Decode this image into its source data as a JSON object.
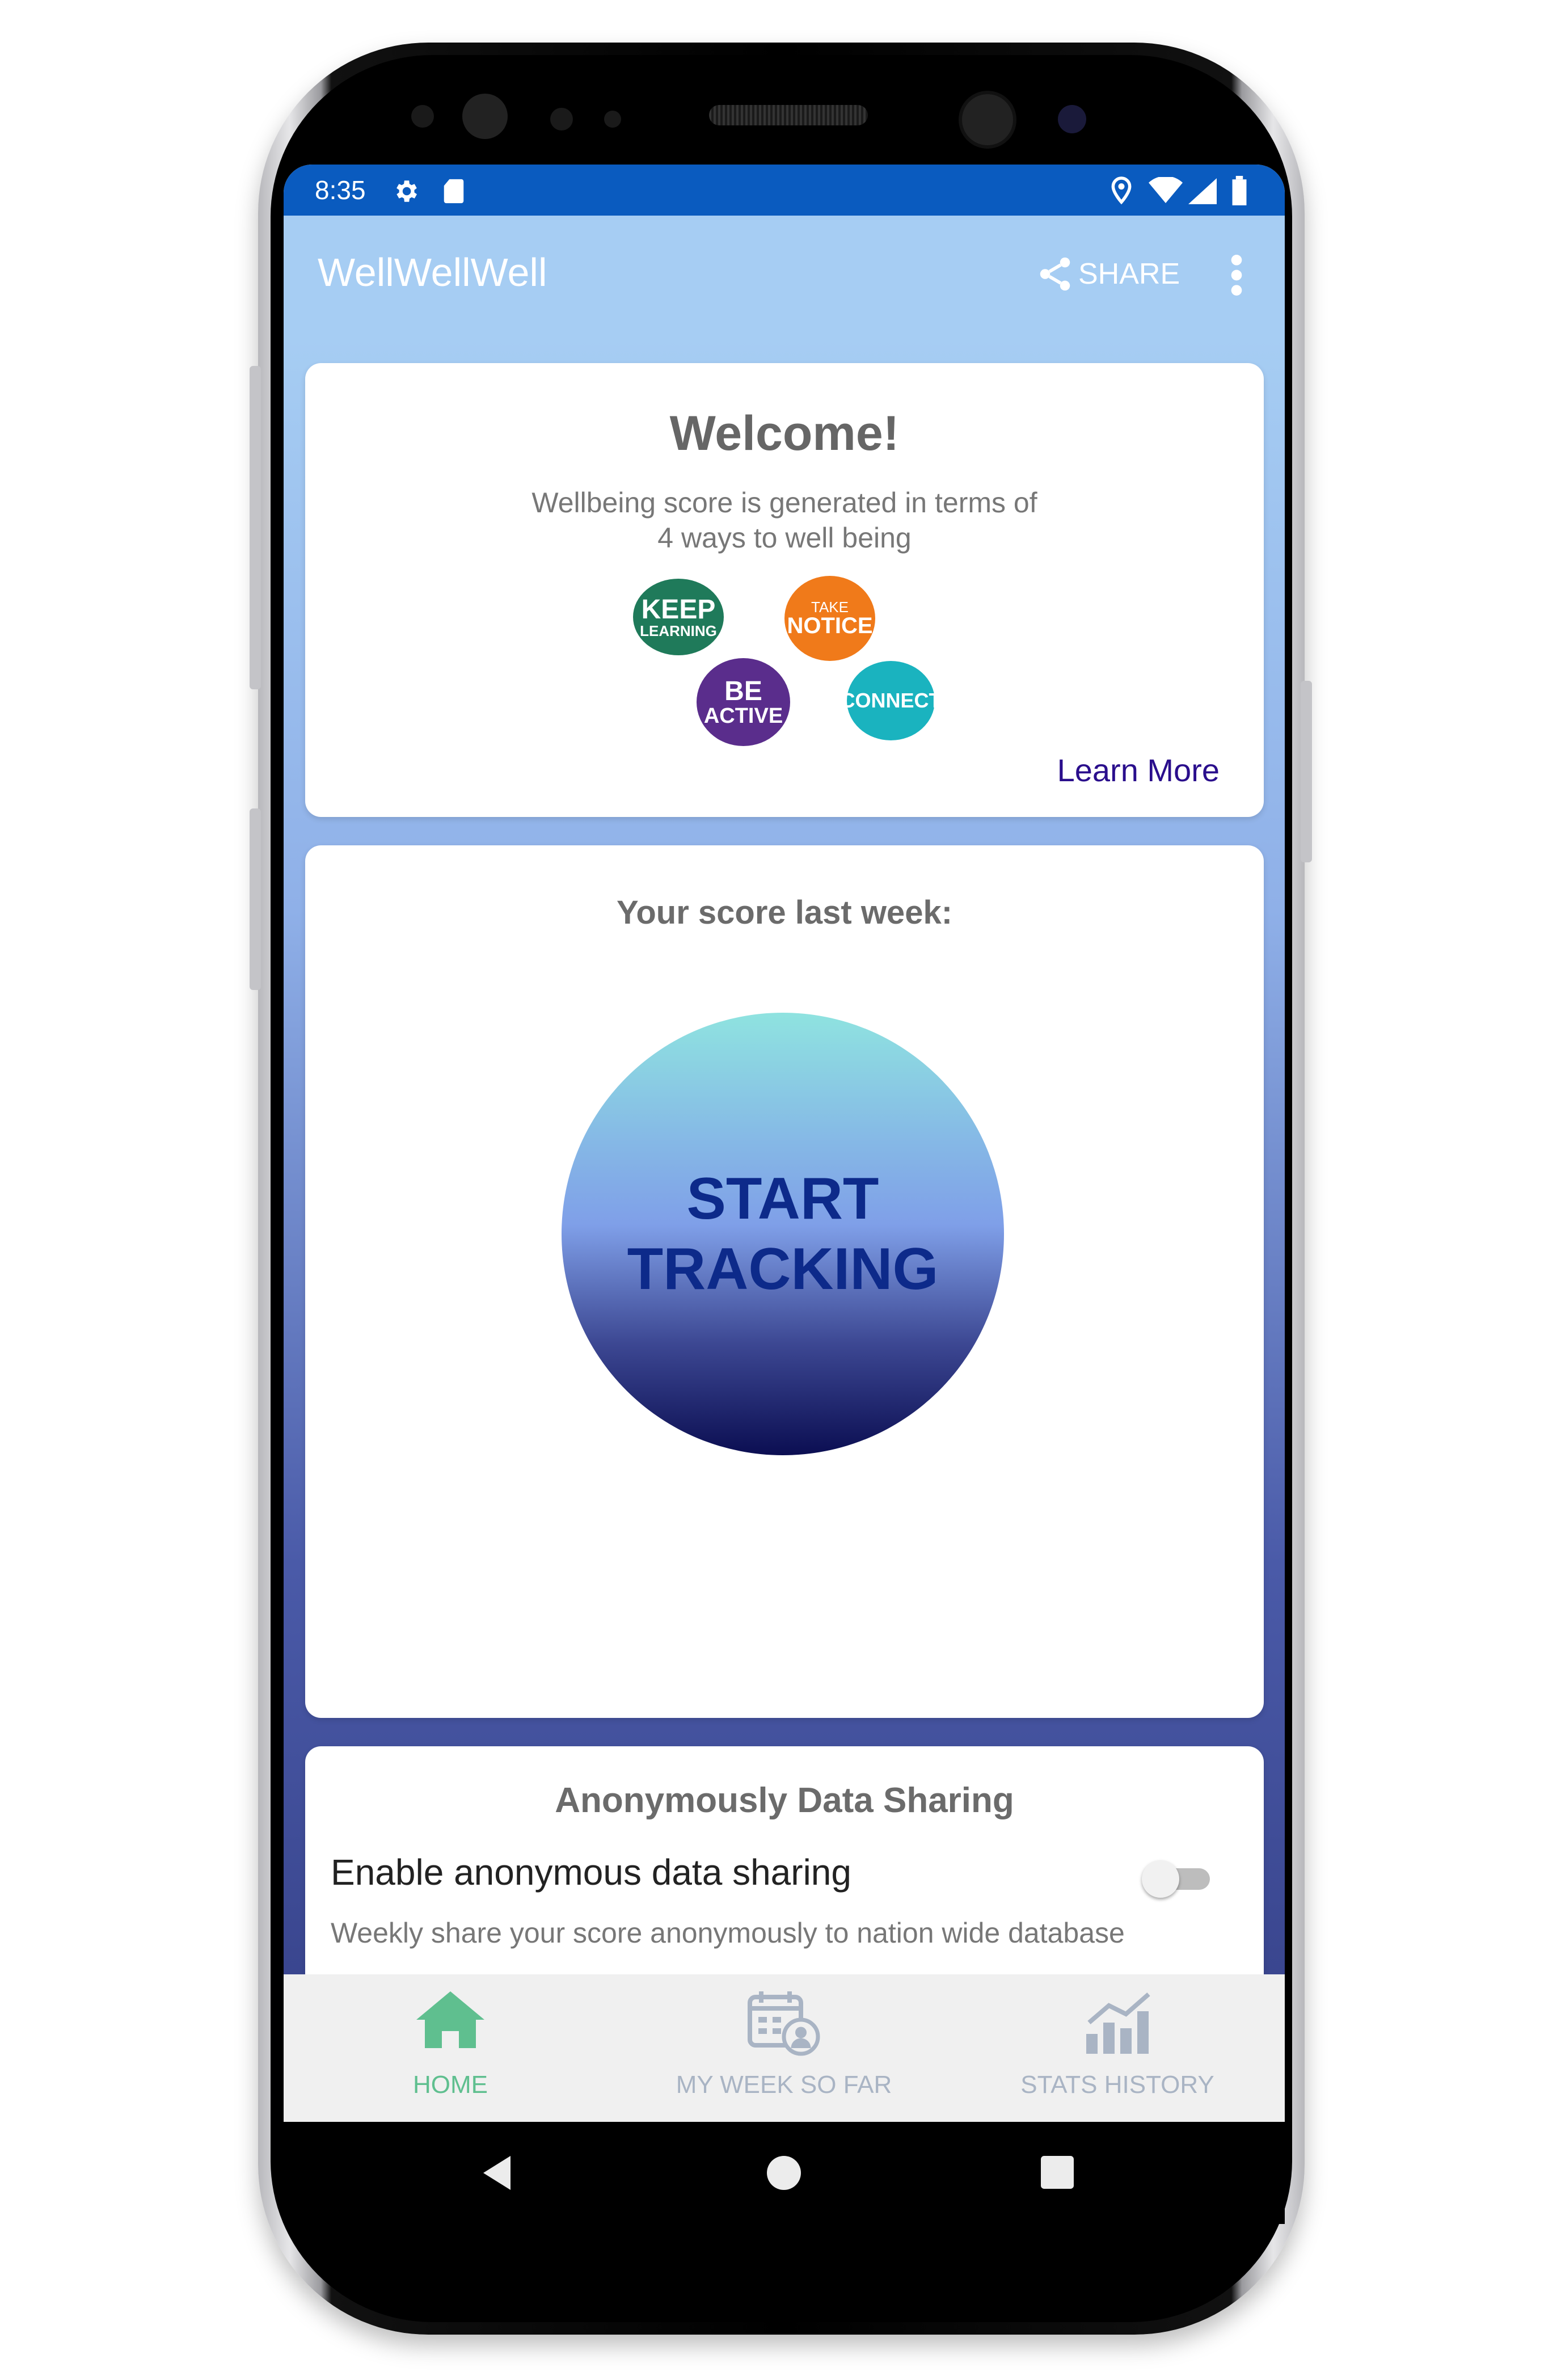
{
  "status_bar": {
    "time": "8:35"
  },
  "app_bar": {
    "title": "WellWellWell",
    "share_label": "SHARE"
  },
  "welcome_card": {
    "title": "Welcome!",
    "subtitle_line1": "Wellbeing score is generated in terms of",
    "subtitle_line2": "4 ways to well being",
    "badges": [
      {
        "line1": "KEEP",
        "line2": "LEARNING",
        "color": "#1f7a5a"
      },
      {
        "line1": "TAKE",
        "line2": "NOTICE",
        "color": "#f07a1a"
      },
      {
        "line1": "BE",
        "line2": "ACTIVE",
        "color": "#5a2d8c"
      },
      {
        "line1": "CONNECT",
        "line2": "",
        "color": "#1ab3bf"
      }
    ],
    "learn_more": "Learn More"
  },
  "score_card": {
    "title": "Your score last week:",
    "button_line1": "START",
    "button_line2": "TRACKING"
  },
  "sharing_card": {
    "title": "Anonymously Data Sharing",
    "toggle_label": "Enable anonymous data sharing",
    "toggle_on": false,
    "description": "Weekly share your score anonymously to nation wide database"
  },
  "bottom_nav": {
    "items": [
      {
        "label": "HOME",
        "active": true
      },
      {
        "label": "MY WEEK SO FAR",
        "active": false
      },
      {
        "label": "STATS HISTORY",
        "active": false
      }
    ]
  },
  "colors": {
    "status_bar": "#0a5bbf",
    "app_bar": "#a6cdf3",
    "accent_nav": "#5fbf8f",
    "nav_inactive": "#a9b4c4",
    "link": "#2a0e8c"
  }
}
